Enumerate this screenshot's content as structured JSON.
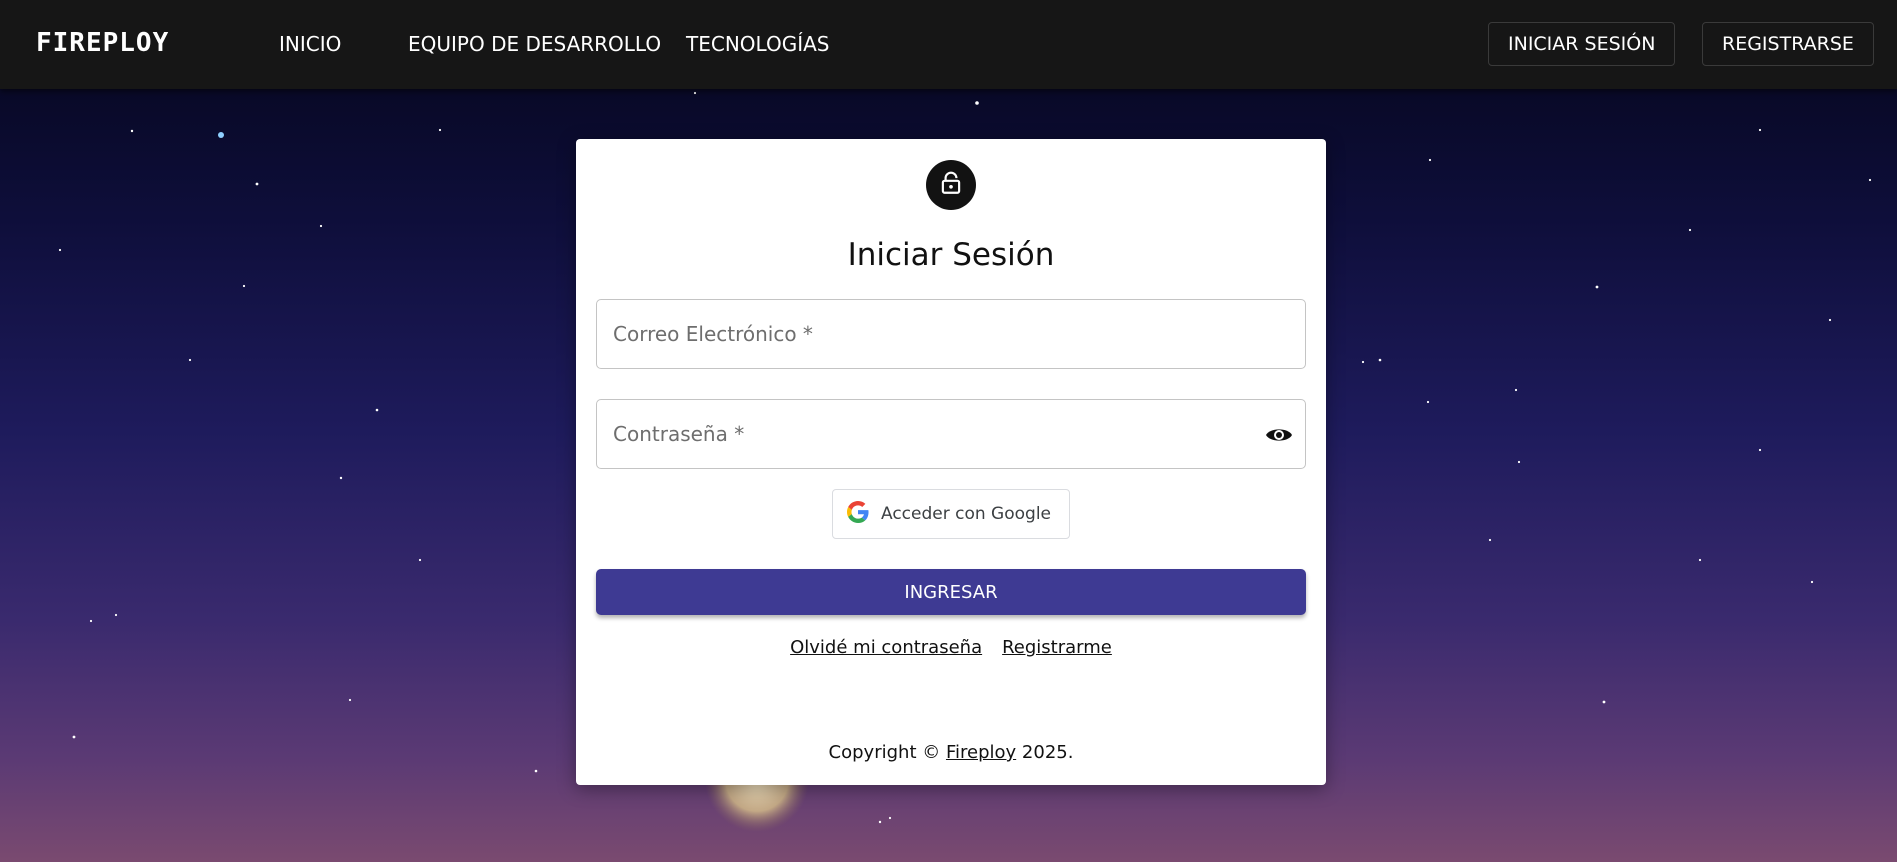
{
  "app": {
    "brand": "FIREPLOY"
  },
  "nav": {
    "links": [
      "INICIO",
      "EQUIPO DE DESARROLLO",
      "TECNOLOGÍAS"
    ],
    "login_button": "INICIAR SESIÓN",
    "register_button": "REGISTRARSE"
  },
  "login": {
    "lock_icon": "lock-icon",
    "title": "Iniciar Sesión",
    "email_placeholder": "Correo Electrónico *",
    "email_value": "",
    "password_placeholder": "Contraseña *",
    "password_value": "",
    "password_toggle_icon": "eye-icon",
    "google_label": "Acceder con Google",
    "submit_label": "INGRESAR",
    "forgot_link": "Olvidé mi contraseña",
    "register_link": "Registrarme",
    "copyright_prefix": "Copyright ©",
    "copyright_brand": "Fireploy",
    "copyright_suffix": "2025."
  },
  "colors": {
    "navbar": "#161616",
    "primary_button": "#3e3a93",
    "lock_avatar": "#121212"
  }
}
